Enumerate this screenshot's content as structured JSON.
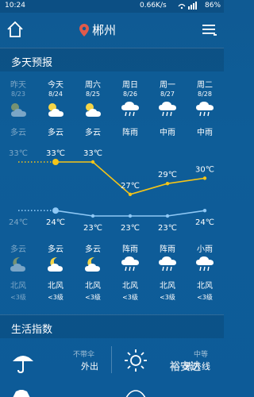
{
  "status_bar": {
    "time": "10:24",
    "network_speed": "0.66K/s",
    "battery": "86%"
  },
  "topbar": {
    "city": "郴州",
    "accent_color": "#e05a4a"
  },
  "forecast": {
    "title": "多天预报",
    "days": [
      {
        "name": "昨天",
        "date": "8/23",
        "cond": "多云",
        "icon": "partly-cloudy-icon",
        "high": 33,
        "high_label": "33℃",
        "past": true
      },
      {
        "name": "今天",
        "date": "8/24",
        "cond": "多云",
        "icon": "partly-cloudy-icon",
        "high": 33,
        "high_label": "33℃",
        "past": false
      },
      {
        "name": "周六",
        "date": "8/25",
        "cond": "多云",
        "icon": "partly-cloudy-icon",
        "high": 33,
        "high_label": "33℃",
        "past": false
      },
      {
        "name": "周日",
        "date": "8/26",
        "cond": "阵雨",
        "icon": "rain-icon",
        "high": 27,
        "high_label": "27℃",
        "past": false
      },
      {
        "name": "周一",
        "date": "8/27",
        "cond": "中雨",
        "icon": "rain-icon",
        "high": 29,
        "high_label": "29℃",
        "past": false
      },
      {
        "name": "周二",
        "date": "8/28",
        "cond": "中雨",
        "icon": "rain-icon",
        "high": 30,
        "high_label": "30℃",
        "past": false
      }
    ],
    "nights": [
      {
        "low": 24,
        "low_label": "24℃",
        "cond": "多云",
        "icon": "cloudy-night-icon",
        "wind": "北风",
        "level": "<3级",
        "past": true
      },
      {
        "low": 24,
        "low_label": "24℃",
        "cond": "多云",
        "icon": "cloudy-night-icon",
        "wind": "北风",
        "level": "<3级",
        "past": false
      },
      {
        "low": 23,
        "low_label": "23℃",
        "cond": "多云",
        "icon": "cloudy-night-icon",
        "wind": "北风",
        "level": "<3级",
        "past": false
      },
      {
        "low": 23,
        "low_label": "23℃",
        "cond": "阵雨",
        "icon": "rain-icon",
        "wind": "北风",
        "level": "<3级",
        "past": false
      },
      {
        "low": 23,
        "low_label": "23℃",
        "cond": "阵雨",
        "icon": "rain-icon",
        "wind": "北风",
        "level": "<3级",
        "past": false
      },
      {
        "low": 24,
        "low_label": "24℃",
        "cond": "小雨",
        "icon": "rain-icon",
        "wind": "北风",
        "level": "<3级",
        "past": false
      }
    ],
    "high_line_color": "#f5c518",
    "low_line_color": "#8fc8f5"
  },
  "life": {
    "title": "生活指数",
    "umbrella": {
      "sub": "不带伞",
      "main": "外出"
    },
    "uv": {
      "sub": "中等",
      "main": "紫外线"
    }
  },
  "watermark": "裕安达"
}
